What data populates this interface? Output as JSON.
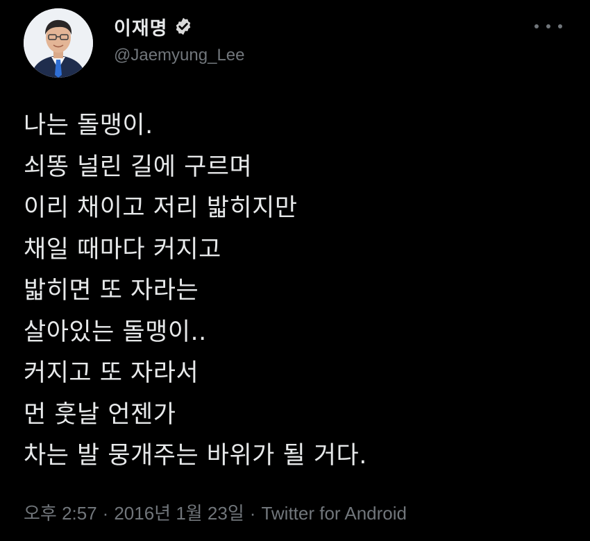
{
  "user": {
    "display_name": "이재명",
    "handle": "@Jaemyung_Lee",
    "verified_icon": "verified-badge-icon",
    "avatar": "profile-photo"
  },
  "more_icon": "more-options-icon",
  "tweet": {
    "lines": [
      "나는 돌맹이.",
      "쇠똥 널린 길에 구르며",
      "이리 채이고 저리 밟히지만",
      "채일 때마다 커지고",
      "밟히면 또 자라는",
      "살아있는 돌맹이..",
      "커지고 또 자라서",
      "먼 훗날 언젠가",
      "차는 발 뭉개주는 바위가 될 거다."
    ]
  },
  "meta": {
    "time": "오후 2:57",
    "separator": "·",
    "date": "2016년 1월 23일",
    "source": "Twitter for Android"
  },
  "colors": {
    "background": "#000000",
    "text": "#e7e9ea",
    "secondary": "#71767b",
    "badge": "#d9d9d9"
  }
}
